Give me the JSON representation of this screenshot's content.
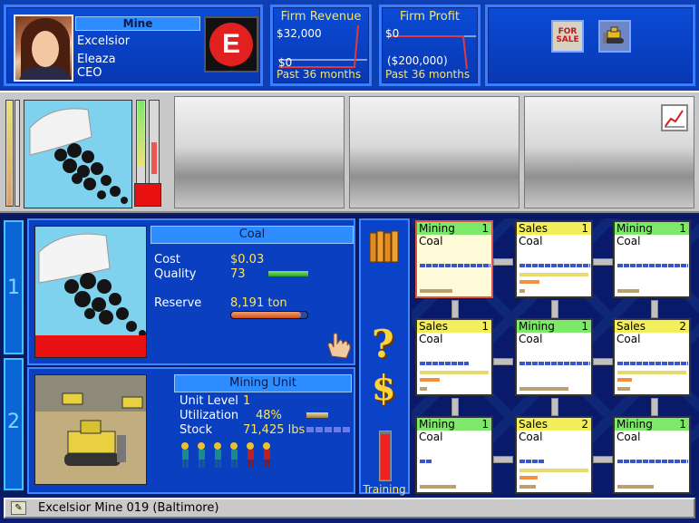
{
  "ceo": {
    "header": "Mine",
    "company": "Excelsior",
    "name": "Eleaza",
    "title": "CEO",
    "logo_letter": "E"
  },
  "revenue": {
    "title": "Firm Revenue",
    "top_value": "$32,000",
    "bottom_value": "$0",
    "footer": "Past 36 months"
  },
  "profit": {
    "title": "Firm Profit",
    "top_value": "$0",
    "bottom_value": "($200,000)",
    "footer": "Past 36 months"
  },
  "tools": {
    "for_sale_line1": "FOR",
    "for_sale_line2": "SALE"
  },
  "product": {
    "header": "Coal",
    "cost_label": "Cost",
    "cost_value": "$0.03",
    "quality_label": "Quality",
    "quality_value": "73",
    "reserve_label": "Reserve",
    "reserve_value": "8,191 ton"
  },
  "unit": {
    "header": "Mining Unit",
    "level_label": "Unit Level",
    "level_value": "1",
    "util_label": "Utilization",
    "util_value": "48%",
    "stock_label": "Stock",
    "stock_value": "71,425 lbs"
  },
  "side_tabs": {
    "tab1": "1",
    "tab2": "2"
  },
  "actions": {
    "training_label": "Training"
  },
  "grid": {
    "cells": [
      {
        "type": "Mining",
        "count": "1",
        "item": "Coal"
      },
      {
        "type": "Sales",
        "count": "1",
        "item": "Coal"
      },
      {
        "type": "Mining",
        "count": "1",
        "item": "Coal"
      },
      {
        "type": "Sales",
        "count": "1",
        "item": "Coal"
      },
      {
        "type": "Mining",
        "count": "1",
        "item": "Coal"
      },
      {
        "type": "Sales",
        "count": "2",
        "item": "Coal"
      },
      {
        "type": "Mining",
        "count": "1",
        "item": "Coal"
      },
      {
        "type": "Sales",
        "count": "2",
        "item": "Coal"
      },
      {
        "type": "Mining",
        "count": "1",
        "item": "Coal"
      }
    ]
  },
  "status": {
    "text": "Excelsior Mine 019 (Baltimore)"
  },
  "colors": {
    "panel_blue": "#0a3fbf",
    "accent_yellow": "#ffe45a",
    "header_blue": "#2d8cff",
    "mining_green": "#7de86a",
    "sales_yellow": "#f3ee5c"
  }
}
